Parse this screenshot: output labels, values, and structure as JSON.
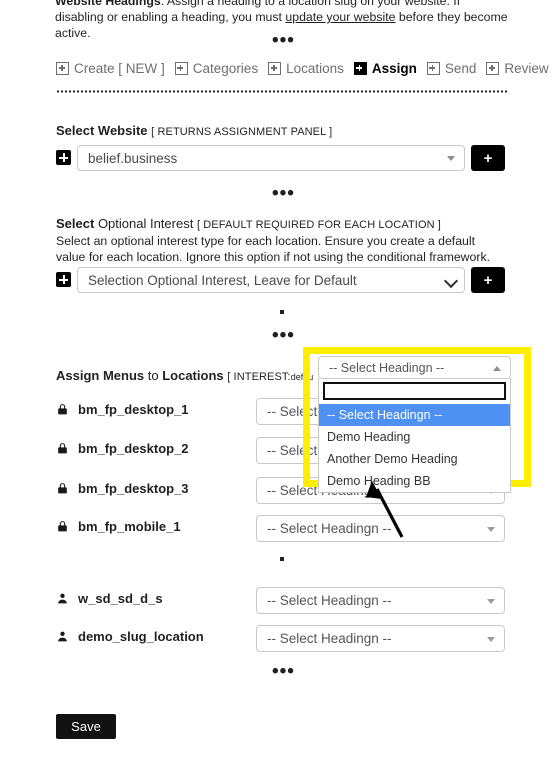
{
  "intro": {
    "lead": "Website Headings",
    "text_before_link": ": Assign a heading to a location slug on your website. If disabling or enabling a heading, you must ",
    "link_text": "update your website",
    "text_after_link": " before they become active."
  },
  "nav": {
    "items": [
      {
        "label": "Create [ NEW ]",
        "icon": "plus-box-icon",
        "active": false
      },
      {
        "label": "Categories",
        "icon": "plus-box-icon",
        "active": false
      },
      {
        "label": "Locations",
        "icon": "plus-box-icon",
        "active": false
      },
      {
        "label": "Assign",
        "icon": "plus-box-icon",
        "active": true
      },
      {
        "label": "Send",
        "icon": "plus-box-icon",
        "active": false
      },
      {
        "label": "Review",
        "icon": "plus-box-icon",
        "active": false
      }
    ]
  },
  "website_section": {
    "label_bold": "Select Website",
    "label_bracket": "[ RETURNS ASSIGNMENT PANEL ]",
    "select_value": "belief.business",
    "add_button": "+"
  },
  "interest_section": {
    "label_part1": "Select",
    "label_part2": "Optional Interest",
    "label_bracket": "[ DEFAULT REQUIRED FOR EACH LOCATION ]",
    "help": "Select an optional interest type for each location. Ensure you create a default value for each location. Ignore this option if not using the conditional framework.",
    "select_value": "Selection Optional Interest, Leave for Default",
    "add_button": "+"
  },
  "assign_section": {
    "title_a": "Assign Menus",
    "title_b": "to",
    "title_c": "Locations",
    "title_bracket_open": "[ INTEREST:",
    "title_bracket_value": "defau",
    "placeholder": "-- Select Headingn --",
    "rows": [
      {
        "name": "bm_fp_desktop_1",
        "icon": "lock-icon",
        "value": "-- Select Headingn --"
      },
      {
        "name": "bm_fp_desktop_2",
        "icon": "lock-icon",
        "value": "-- Select Headingn --"
      },
      {
        "name": "bm_fp_desktop_3",
        "icon": "lock-icon",
        "value": "-- Select Headingn --"
      },
      {
        "name": "bm_fp_mobile_1",
        "icon": "lock-icon",
        "value": "-- Select Headingn --"
      },
      {
        "name": "w_sd_sd_d_s",
        "icon": "user-icon",
        "value": "-- Select Headingn --"
      },
      {
        "name": "demo_slug_location",
        "icon": "user-icon",
        "value": "-- Select Headingn --"
      }
    ]
  },
  "dropdown": {
    "toggle_label": "-- Select Headingn --",
    "search_value": "",
    "search_placeholder": "",
    "options": [
      {
        "label": "-- Select Headingn --",
        "selected": true
      },
      {
        "label": "Demo Heading",
        "selected": false
      },
      {
        "label": "Another Demo Heading",
        "selected": false
      },
      {
        "label": "Demo Heading BB",
        "selected": false
      }
    ]
  },
  "footer": {
    "save_label": "Save"
  },
  "colors": {
    "highlight_box": "#ffee00",
    "option_selected_bg": "#4f91f2",
    "accent_black": "#000000"
  },
  "separators": {
    "dots": "•••"
  }
}
